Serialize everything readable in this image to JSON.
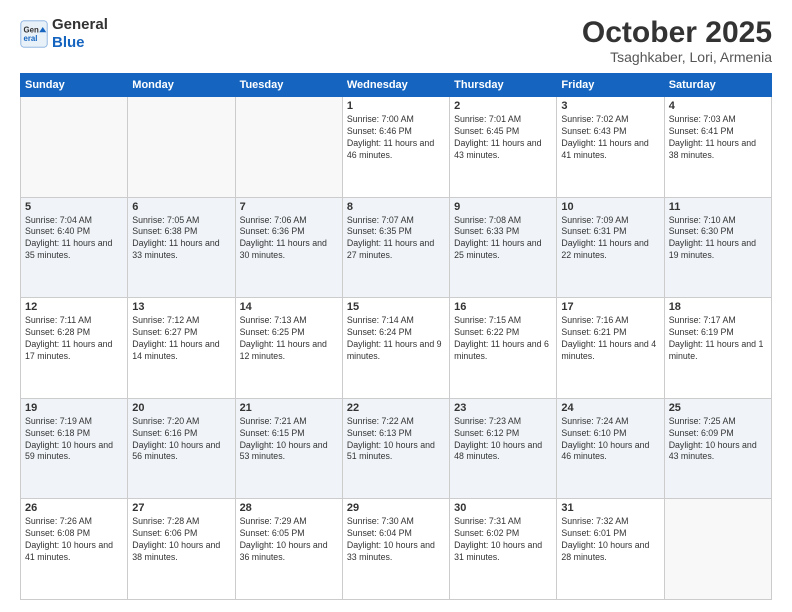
{
  "header": {
    "logo_line1": "General",
    "logo_line2": "Blue",
    "title": "October 2025",
    "subtitle": "Tsaghkaber, Lori, Armenia"
  },
  "weekdays": [
    "Sunday",
    "Monday",
    "Tuesday",
    "Wednesday",
    "Thursday",
    "Friday",
    "Saturday"
  ],
  "weeks": [
    [
      {
        "day": "",
        "sunrise": "",
        "sunset": "",
        "daylight": ""
      },
      {
        "day": "",
        "sunrise": "",
        "sunset": "",
        "daylight": ""
      },
      {
        "day": "",
        "sunrise": "",
        "sunset": "",
        "daylight": ""
      },
      {
        "day": "1",
        "sunrise": "Sunrise: 7:00 AM",
        "sunset": "Sunset: 6:46 PM",
        "daylight": "Daylight: 11 hours and 46 minutes."
      },
      {
        "day": "2",
        "sunrise": "Sunrise: 7:01 AM",
        "sunset": "Sunset: 6:45 PM",
        "daylight": "Daylight: 11 hours and 43 minutes."
      },
      {
        "day": "3",
        "sunrise": "Sunrise: 7:02 AM",
        "sunset": "Sunset: 6:43 PM",
        "daylight": "Daylight: 11 hours and 41 minutes."
      },
      {
        "day": "4",
        "sunrise": "Sunrise: 7:03 AM",
        "sunset": "Sunset: 6:41 PM",
        "daylight": "Daylight: 11 hours and 38 minutes."
      }
    ],
    [
      {
        "day": "5",
        "sunrise": "Sunrise: 7:04 AM",
        "sunset": "Sunset: 6:40 PM",
        "daylight": "Daylight: 11 hours and 35 minutes."
      },
      {
        "day": "6",
        "sunrise": "Sunrise: 7:05 AM",
        "sunset": "Sunset: 6:38 PM",
        "daylight": "Daylight: 11 hours and 33 minutes."
      },
      {
        "day": "7",
        "sunrise": "Sunrise: 7:06 AM",
        "sunset": "Sunset: 6:36 PM",
        "daylight": "Daylight: 11 hours and 30 minutes."
      },
      {
        "day": "8",
        "sunrise": "Sunrise: 7:07 AM",
        "sunset": "Sunset: 6:35 PM",
        "daylight": "Daylight: 11 hours and 27 minutes."
      },
      {
        "day": "9",
        "sunrise": "Sunrise: 7:08 AM",
        "sunset": "Sunset: 6:33 PM",
        "daylight": "Daylight: 11 hours and 25 minutes."
      },
      {
        "day": "10",
        "sunrise": "Sunrise: 7:09 AM",
        "sunset": "Sunset: 6:31 PM",
        "daylight": "Daylight: 11 hours and 22 minutes."
      },
      {
        "day": "11",
        "sunrise": "Sunrise: 7:10 AM",
        "sunset": "Sunset: 6:30 PM",
        "daylight": "Daylight: 11 hours and 19 minutes."
      }
    ],
    [
      {
        "day": "12",
        "sunrise": "Sunrise: 7:11 AM",
        "sunset": "Sunset: 6:28 PM",
        "daylight": "Daylight: 11 hours and 17 minutes."
      },
      {
        "day": "13",
        "sunrise": "Sunrise: 7:12 AM",
        "sunset": "Sunset: 6:27 PM",
        "daylight": "Daylight: 11 hours and 14 minutes."
      },
      {
        "day": "14",
        "sunrise": "Sunrise: 7:13 AM",
        "sunset": "Sunset: 6:25 PM",
        "daylight": "Daylight: 11 hours and 12 minutes."
      },
      {
        "day": "15",
        "sunrise": "Sunrise: 7:14 AM",
        "sunset": "Sunset: 6:24 PM",
        "daylight": "Daylight: 11 hours and 9 minutes."
      },
      {
        "day": "16",
        "sunrise": "Sunrise: 7:15 AM",
        "sunset": "Sunset: 6:22 PM",
        "daylight": "Daylight: 11 hours and 6 minutes."
      },
      {
        "day": "17",
        "sunrise": "Sunrise: 7:16 AM",
        "sunset": "Sunset: 6:21 PM",
        "daylight": "Daylight: 11 hours and 4 minutes."
      },
      {
        "day": "18",
        "sunrise": "Sunrise: 7:17 AM",
        "sunset": "Sunset: 6:19 PM",
        "daylight": "Daylight: 11 hours and 1 minute."
      }
    ],
    [
      {
        "day": "19",
        "sunrise": "Sunrise: 7:19 AM",
        "sunset": "Sunset: 6:18 PM",
        "daylight": "Daylight: 10 hours and 59 minutes."
      },
      {
        "day": "20",
        "sunrise": "Sunrise: 7:20 AM",
        "sunset": "Sunset: 6:16 PM",
        "daylight": "Daylight: 10 hours and 56 minutes."
      },
      {
        "day": "21",
        "sunrise": "Sunrise: 7:21 AM",
        "sunset": "Sunset: 6:15 PM",
        "daylight": "Daylight: 10 hours and 53 minutes."
      },
      {
        "day": "22",
        "sunrise": "Sunrise: 7:22 AM",
        "sunset": "Sunset: 6:13 PM",
        "daylight": "Daylight: 10 hours and 51 minutes."
      },
      {
        "day": "23",
        "sunrise": "Sunrise: 7:23 AM",
        "sunset": "Sunset: 6:12 PM",
        "daylight": "Daylight: 10 hours and 48 minutes."
      },
      {
        "day": "24",
        "sunrise": "Sunrise: 7:24 AM",
        "sunset": "Sunset: 6:10 PM",
        "daylight": "Daylight: 10 hours and 46 minutes."
      },
      {
        "day": "25",
        "sunrise": "Sunrise: 7:25 AM",
        "sunset": "Sunset: 6:09 PM",
        "daylight": "Daylight: 10 hours and 43 minutes."
      }
    ],
    [
      {
        "day": "26",
        "sunrise": "Sunrise: 7:26 AM",
        "sunset": "Sunset: 6:08 PM",
        "daylight": "Daylight: 10 hours and 41 minutes."
      },
      {
        "day": "27",
        "sunrise": "Sunrise: 7:28 AM",
        "sunset": "Sunset: 6:06 PM",
        "daylight": "Daylight: 10 hours and 38 minutes."
      },
      {
        "day": "28",
        "sunrise": "Sunrise: 7:29 AM",
        "sunset": "Sunset: 6:05 PM",
        "daylight": "Daylight: 10 hours and 36 minutes."
      },
      {
        "day": "29",
        "sunrise": "Sunrise: 7:30 AM",
        "sunset": "Sunset: 6:04 PM",
        "daylight": "Daylight: 10 hours and 33 minutes."
      },
      {
        "day": "30",
        "sunrise": "Sunrise: 7:31 AM",
        "sunset": "Sunset: 6:02 PM",
        "daylight": "Daylight: 10 hours and 31 minutes."
      },
      {
        "day": "31",
        "sunrise": "Sunrise: 7:32 AM",
        "sunset": "Sunset: 6:01 PM",
        "daylight": "Daylight: 10 hours and 28 minutes."
      },
      {
        "day": "",
        "sunrise": "",
        "sunset": "",
        "daylight": ""
      }
    ]
  ]
}
